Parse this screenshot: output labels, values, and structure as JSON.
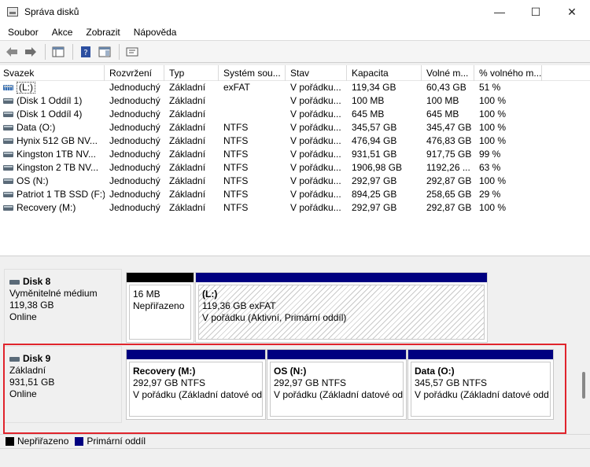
{
  "window": {
    "title": "Správa disků",
    "minimize": "—",
    "maximize": "☐",
    "close": "✕"
  },
  "menu": [
    "Soubor",
    "Akce",
    "Zobrazit",
    "Nápověda"
  ],
  "columns": [
    "Svazek",
    "Rozvržení",
    "Typ",
    "Systém sou...",
    "Stav",
    "Kapacita",
    "Volné m...",
    "% volného m..."
  ],
  "volumes": [
    {
      "name": "(L:)",
      "layout": "Jednoduchý",
      "type": "Základní",
      "fs": "exFAT",
      "status": "V pořádku...",
      "capacity": "119,34 GB",
      "free": "60,43 GB",
      "pct": "51 %",
      "icon": "removable-volume-icon"
    },
    {
      "name": "(Disk 1 Oddíl 1)",
      "layout": "Jednoduchý",
      "type": "Základní",
      "fs": "",
      "status": "V pořádku...",
      "capacity": "100 MB",
      "free": "100 MB",
      "pct": "100 %",
      "icon": "volume-icon"
    },
    {
      "name": "(Disk 1 Oddíl 4)",
      "layout": "Jednoduchý",
      "type": "Základní",
      "fs": "",
      "status": "V pořádku...",
      "capacity": "645 MB",
      "free": "645 MB",
      "pct": "100 %",
      "icon": "volume-icon"
    },
    {
      "name": "Data (O:)",
      "layout": "Jednoduchý",
      "type": "Základní",
      "fs": "NTFS",
      "status": "V pořádku...",
      "capacity": "345,57 GB",
      "free": "345,47 GB",
      "pct": "100 %",
      "icon": "volume-icon"
    },
    {
      "name": "Hynix 512 GB NV...",
      "layout": "Jednoduchý",
      "type": "Základní",
      "fs": "NTFS",
      "status": "V pořádku...",
      "capacity": "476,94 GB",
      "free": "476,83 GB",
      "pct": "100 %",
      "icon": "volume-icon"
    },
    {
      "name": "Kingston 1TB NV...",
      "layout": "Jednoduchý",
      "type": "Základní",
      "fs": "NTFS",
      "status": "V pořádku...",
      "capacity": "931,51 GB",
      "free": "917,75 GB",
      "pct": "99 %",
      "icon": "volume-icon"
    },
    {
      "name": "Kingston 2 TB NV...",
      "layout": "Jednoduchý",
      "type": "Základní",
      "fs": "NTFS",
      "status": "V pořádku...",
      "capacity": "1906,98 GB",
      "free": "1192,26 ...",
      "pct": "63 %",
      "icon": "volume-icon"
    },
    {
      "name": "OS (N:)",
      "layout": "Jednoduchý",
      "type": "Základní",
      "fs": "NTFS",
      "status": "V pořádku...",
      "capacity": "292,97 GB",
      "free": "292,87 GB",
      "pct": "100 %",
      "icon": "volume-icon"
    },
    {
      "name": "Patriot 1 TB SSD (F:)",
      "layout": "Jednoduchý",
      "type": "Základní",
      "fs": "NTFS",
      "status": "V pořádku...",
      "capacity": "894,25 GB",
      "free": "258,65 GB",
      "pct": "29 %",
      "icon": "volume-icon"
    },
    {
      "name": "Recovery (M:)",
      "layout": "Jednoduchý",
      "type": "Základní",
      "fs": "NTFS",
      "status": "V pořádku...",
      "capacity": "292,97 GB",
      "free": "292,87 GB",
      "pct": "100 %",
      "icon": "volume-icon"
    }
  ],
  "disks": {
    "disk8": {
      "title": "Disk 8",
      "kind": "Vyměnitelné médium",
      "size": "119,38 GB",
      "state": "Online",
      "unallocated": {
        "size": "16 MB",
        "label": "Nepřiřazeno"
      },
      "partition": {
        "name": "(L:)",
        "info": "119,36 GB exFAT",
        "status": "V pořádku (Aktivní, Primární oddíl)"
      }
    },
    "disk9": {
      "title": "Disk 9",
      "kind": "Základní",
      "size": "931,51 GB",
      "state": "Online",
      "partitions": [
        {
          "name": "Recovery  (M:)",
          "info": "292,97 GB NTFS",
          "status": "V pořádku (Základní datové od"
        },
        {
          "name": "OS  (N:)",
          "info": "292,97 GB NTFS",
          "status": "V pořádku (Základní datové od"
        },
        {
          "name": "Data  (O:)",
          "info": "345,57 GB NTFS",
          "status": "V pořádku (Základní datové odd"
        }
      ]
    }
  },
  "legend": [
    {
      "label": "Nepřiřazeno",
      "color": "#000000"
    },
    {
      "label": "Primární oddíl",
      "color": "#000080"
    }
  ],
  "colors": {
    "primary": "#000080",
    "unallocated": "#000000",
    "highlight": "#e0242c"
  }
}
